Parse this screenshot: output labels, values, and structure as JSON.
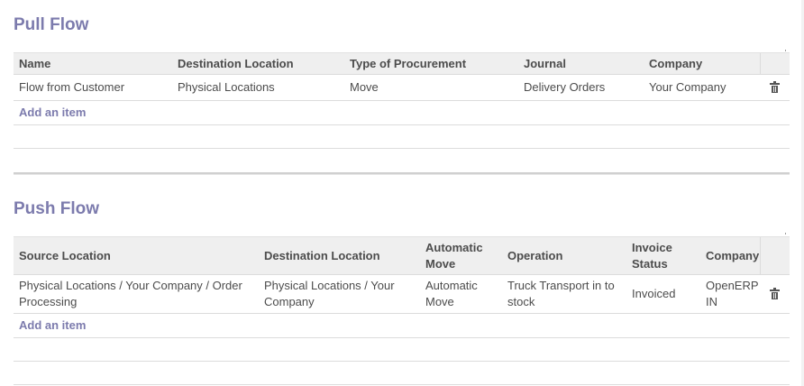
{
  "pull_flow": {
    "title": "Pull Flow",
    "columns": [
      "Name",
      "Destination Location",
      "Type of Procurement",
      "Journal",
      "Company"
    ],
    "rows": [
      [
        "Flow from Customer",
        "Physical Locations",
        "Move",
        "Delivery Orders",
        "Your Company"
      ]
    ],
    "add_label": "Add an item"
  },
  "push_flow": {
    "title": "Push Flow",
    "columns": [
      "Source Location",
      "Destination Location",
      "Automatic Move",
      "Operation",
      "Invoice Status",
      "Company"
    ],
    "rows": [
      [
        "Physical Locations / Your Company / Order Processing",
        "Physical Locations / Your Company",
        "Automatic Move",
        "Truck Transport in to stock",
        "Invoiced",
        "OpenERP IN"
      ]
    ],
    "add_label": "Add an item"
  }
}
